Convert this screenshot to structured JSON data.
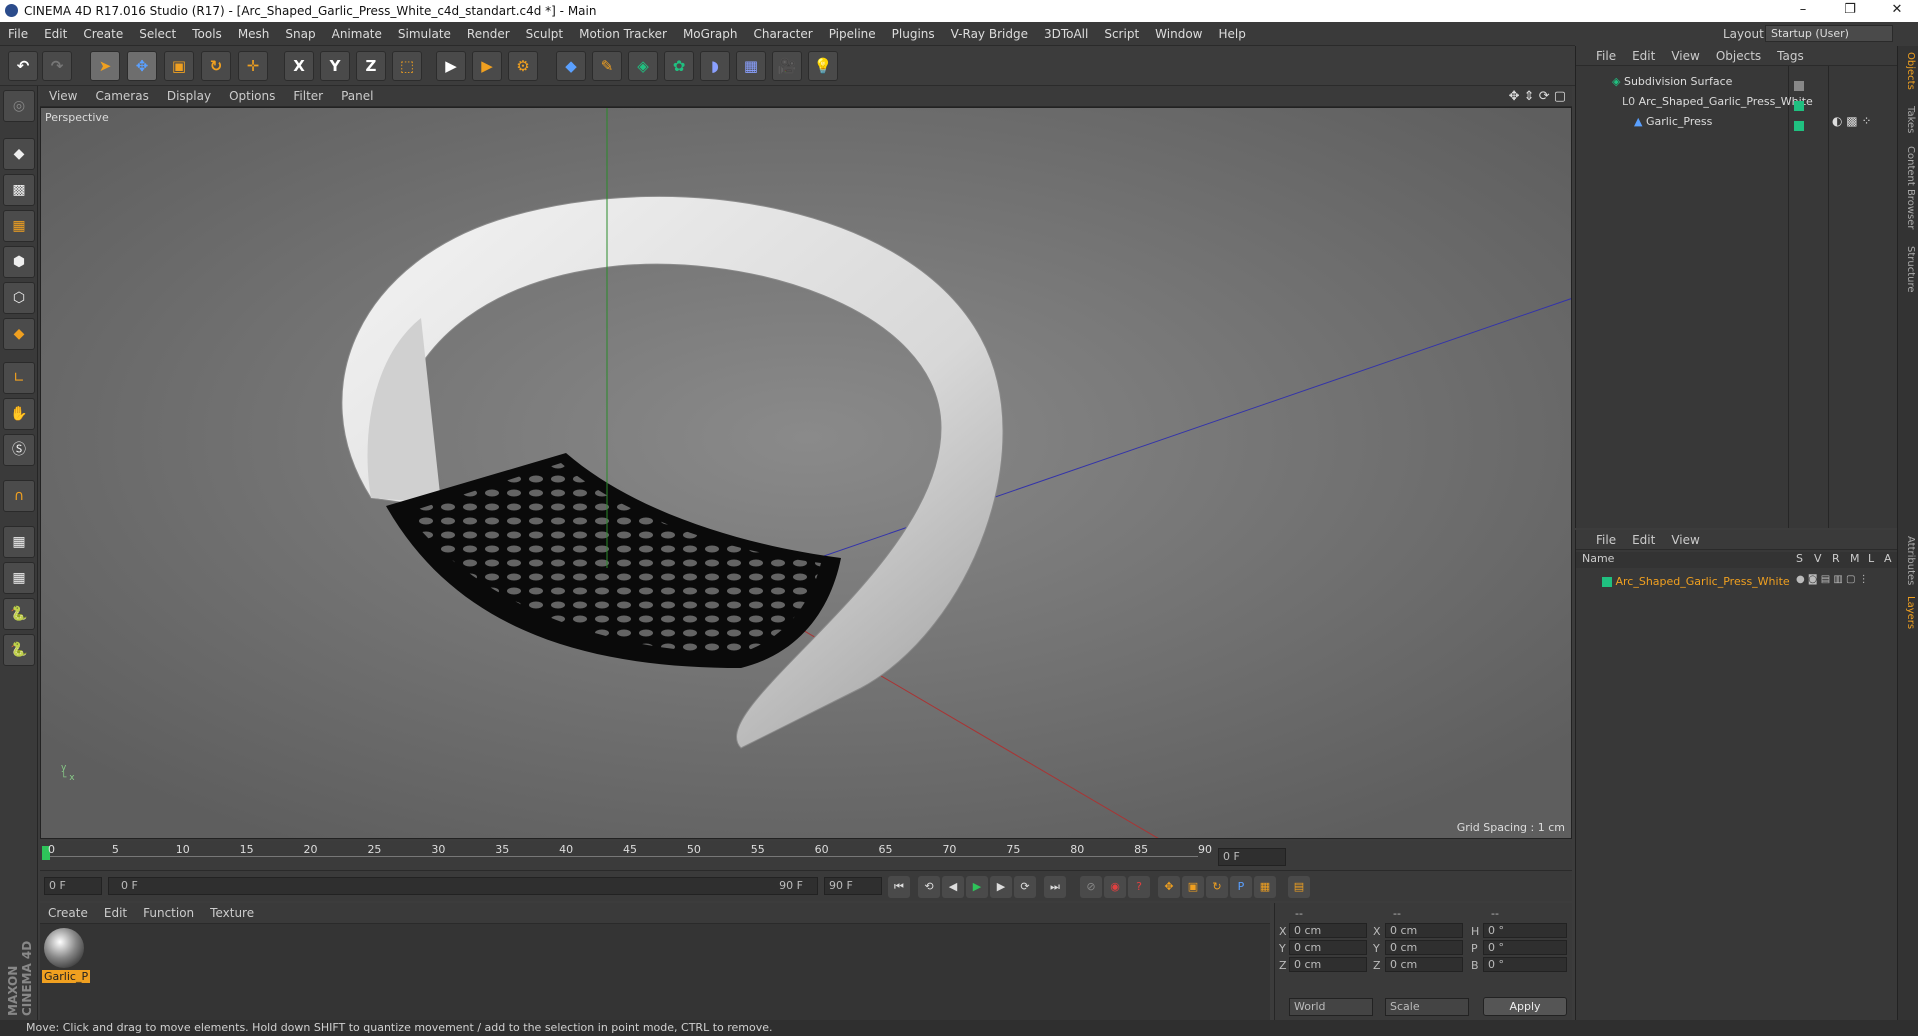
{
  "title": "CINEMA 4D R17.016 Studio (R17) - [Arc_Shaped_Garlic_Press_White_c4d_standart.c4d *] - Main",
  "window_controls": [
    "–",
    "❐",
    "✕"
  ],
  "menu": [
    "File",
    "Edit",
    "Create",
    "Select",
    "Tools",
    "Mesh",
    "Snap",
    "Animate",
    "Simulate",
    "Render",
    "Sculpt",
    "Motion Tracker",
    "MoGraph",
    "Character",
    "Pipeline",
    "Plugins",
    "V-Ray Bridge",
    "3DToAll",
    "Script",
    "Window",
    "Help"
  ],
  "layout": {
    "label": "Layout:",
    "value": "Startup (User)"
  },
  "toolbar": {
    "axis_x": "X",
    "axis_y": "Y",
    "axis_z": "Z"
  },
  "viewport": {
    "menu": [
      "View",
      "Cameras",
      "Display",
      "Options",
      "Filter",
      "Panel"
    ],
    "label": "Perspective",
    "grid_spacing": "Grid Spacing : 1 cm"
  },
  "timeline": {
    "ticks": [
      "0",
      "5",
      "10",
      "15",
      "20",
      "25",
      "30",
      "35",
      "40",
      "45",
      "50",
      "55",
      "60",
      "65",
      "70",
      "75",
      "80",
      "85",
      "90"
    ],
    "current_frame": "0 F"
  },
  "playbar": {
    "start": "0 F",
    "range_start": "0 F",
    "range_end": "90 F",
    "end": "90 F"
  },
  "material_manager": {
    "menu": [
      "Create",
      "Edit",
      "Function",
      "Texture"
    ],
    "material_name": "Garlic_P"
  },
  "coordinates": {
    "headers": [
      "--",
      "--",
      "--"
    ],
    "rows": [
      {
        "axis": "X",
        "pos": "0 cm",
        "size_axis": "X",
        "size": "0 cm",
        "rot_axis": "H",
        "rot": "0 °"
      },
      {
        "axis": "Y",
        "pos": "0 cm",
        "size_axis": "Y",
        "size": "0 cm",
        "rot_axis": "P",
        "rot": "0 °"
      },
      {
        "axis": "Z",
        "pos": "0 cm",
        "size_axis": "Z",
        "size": "0 cm",
        "rot_axis": "B",
        "rot": "0 °"
      }
    ],
    "mode": "World",
    "scale": "Scale",
    "apply": "Apply"
  },
  "object_manager": {
    "menu": [
      "File",
      "Edit",
      "View",
      "Objects",
      "Tags"
    ],
    "objects": [
      {
        "name": "Subdivision Surface"
      },
      {
        "name": "Arc_Shaped_Garlic_Press_White"
      },
      {
        "name": "Garlic_Press"
      }
    ]
  },
  "layer_manager": {
    "menu": [
      "File",
      "Edit",
      "View"
    ],
    "columns": [
      "Name",
      "S",
      "V",
      "R",
      "M",
      "L",
      "A"
    ],
    "layers": [
      {
        "name": "Arc_Shaped_Garlic_Press_White",
        "color": "#20c080"
      }
    ]
  },
  "side_tabs": [
    "Objects",
    "Takes",
    "Content Browser",
    "Structure",
    "Attributes",
    "Layers"
  ],
  "brand": "MAXON CINEMA 4D",
  "status": "Move: Click and drag to move elements. Hold down SHIFT to quantize movement / add to the selection in point mode, CTRL to remove.",
  "colors": {
    "accent": "#20c080",
    "highlight": "#f0a020"
  }
}
